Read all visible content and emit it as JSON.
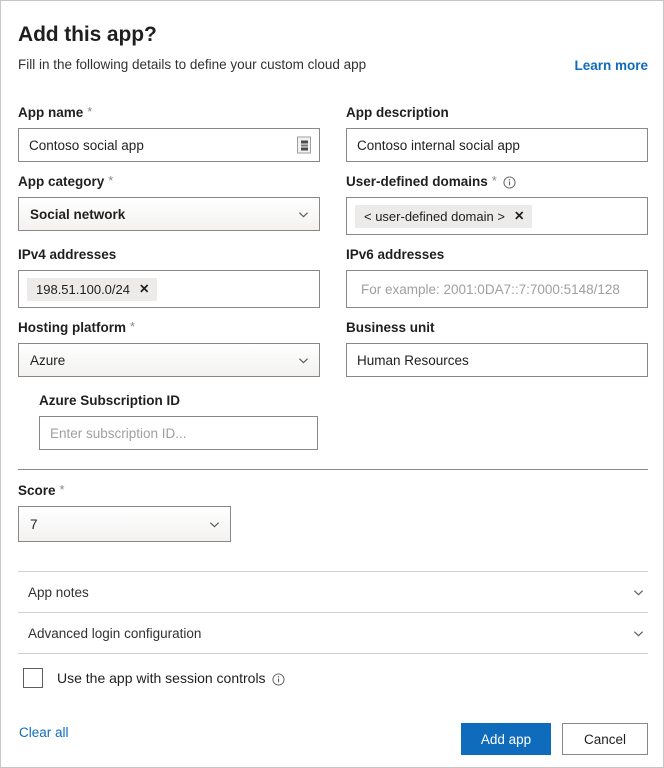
{
  "header": {
    "title": "Add this app?",
    "subtitle": "Fill in the following details to define your custom cloud app",
    "learn_more": "Learn more"
  },
  "fields": {
    "app_name": {
      "label": "App name",
      "required": "*",
      "value": "Contoso social app",
      "icon": "autofill-icon"
    },
    "app_description": {
      "label": "App description",
      "value": "Contoso internal social app"
    },
    "app_category": {
      "label": "App category",
      "required": "*",
      "value": "Social network"
    },
    "user_defined_domains": {
      "label": "User-defined domains",
      "required": "*",
      "info": "info-icon",
      "chips": [
        "< user-defined domain >"
      ]
    },
    "ipv4_addresses": {
      "label": "IPv4 addresses",
      "chips": [
        "198.51.100.0/24"
      ]
    },
    "ipv6_addresses": {
      "label": "IPv6 addresses",
      "placeholder": "For example: 2001:0DA7::7:7000:5148/128",
      "value": ""
    },
    "hosting_platform": {
      "label": "Hosting platform",
      "required": "*",
      "value": "Azure"
    },
    "business_unit": {
      "label": "Business unit",
      "value": "Human Resources"
    },
    "azure_subscription_id": {
      "label": "Azure Subscription ID",
      "placeholder": "Enter subscription ID...",
      "value": ""
    },
    "score": {
      "label": "Score",
      "required": "*",
      "value": "7"
    }
  },
  "sections": {
    "app_notes": "App notes",
    "advanced_login": "Advanced login configuration"
  },
  "session_controls": {
    "label": "Use the app with session controls",
    "checked": false,
    "info": "info-icon"
  },
  "footer": {
    "clear_all": "Clear all",
    "add_app": "Add app",
    "cancel": "Cancel"
  },
  "colors": {
    "accent": "#0f6cbd",
    "link": "#0f6cbd",
    "text": "#201f1e",
    "border": "#8a8886",
    "chip_bg": "#edebe9"
  }
}
